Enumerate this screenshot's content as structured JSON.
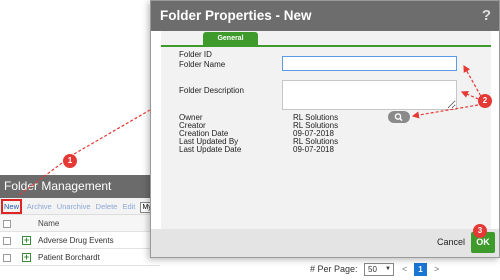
{
  "background": {
    "header_title": "Folder Management",
    "toolbar": {
      "new_label": "New",
      "archive_label": "Archive",
      "unarchive_label": "Unarchive",
      "delete_label": "Delete",
      "edit_label": "Edit",
      "search_value": "My"
    },
    "table": {
      "column_name": "Name",
      "rows": [
        {
          "name": "Adverse Drug Events"
        },
        {
          "name": "Patient Borchardt"
        }
      ]
    },
    "pager": {
      "per_page_label": "# Per Page:",
      "per_page_value": "50",
      "prev": "<",
      "current_page": "1",
      "next": ">"
    }
  },
  "dialog": {
    "title": "Folder Properties - New",
    "help": "?",
    "tab_general": "General",
    "fields": {
      "folder_id_label": "Folder ID",
      "folder_name_label": "Folder Name",
      "folder_description_label": "Folder Description",
      "owner_label": "Owner",
      "owner_value": "RL Solutions",
      "creator_label": "Creator",
      "creator_value": "RL Solutions",
      "creation_date_label": "Creation Date",
      "creation_date_value": "09-07-2018",
      "last_updated_by_label": "Last Updated By",
      "last_updated_by_value": "RL Solutions",
      "last_update_date_label": "Last Update Date",
      "last_update_date_value": "09-07-2018",
      "folder_name_value": "",
      "folder_description_value": ""
    },
    "cancel_label": "Cancel",
    "ok_label": "OK"
  },
  "callouts": [
    "1",
    "2",
    "3"
  ],
  "colors": {
    "accent_green": "#3f9a2c",
    "callout_red": "#e53935",
    "title_gray": "#6d6d6d",
    "page_blue": "#1976d2"
  }
}
